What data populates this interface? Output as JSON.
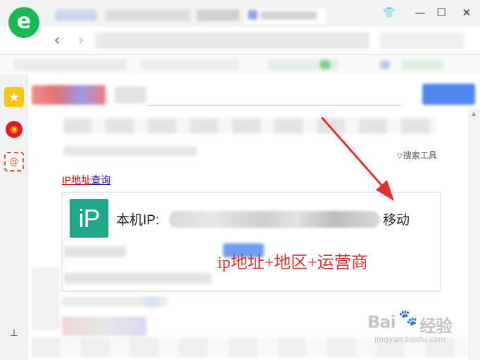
{
  "browser": {
    "logo_letter": "e",
    "window_controls": {
      "skin_icon": "👕",
      "minimize": "—",
      "maximize": "☐",
      "close": "✕"
    },
    "nav": {
      "back": "‹",
      "forward": "›"
    }
  },
  "sidebar": {
    "items": [
      {
        "icon": "star-icon",
        "glyph": "★"
      },
      {
        "icon": "weibo-icon",
        "glyph": "◉"
      },
      {
        "icon": "mail-icon",
        "glyph": "@"
      },
      {
        "icon": "tool-icon",
        "glyph": "⊥"
      }
    ]
  },
  "search": {
    "tools_label": "搜索工具",
    "tools_glyph": "▽"
  },
  "result": {
    "title_part1": "IP地址",
    "title_part2": "查询",
    "card": {
      "badge": "iP",
      "label": "本机IP:",
      "carrier": "移动"
    }
  },
  "annotation": {
    "text": "ip地址+地区+运营商",
    "color": "#d2352f"
  },
  "watermark": {
    "brand": "Bai",
    "paw": "🐾",
    "tail": "经验",
    "domain": "jingyan.baidu.com"
  },
  "colors": {
    "accent_green": "#19b955",
    "ip_badge": "#1fa88a",
    "link_red": "#cc0000",
    "link_blue": "#1a0dab",
    "arrow_red": "#e0322e"
  }
}
